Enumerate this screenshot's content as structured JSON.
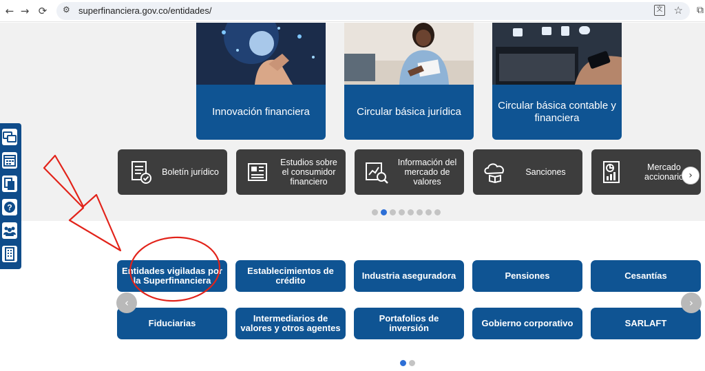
{
  "browser": {
    "url": "superfinanciera.gov.co/entidades/",
    "back_icon": "←",
    "forward_icon": "→",
    "reload_icon": "⟳",
    "site_settings_icon": "⚙",
    "translate_icon": "文",
    "bookmark_icon": "☆",
    "extension_icon": "⧉"
  },
  "feature_cards": [
    {
      "label": "Innovación financiera"
    },
    {
      "label": "Circular básica jurídica"
    },
    {
      "label": "Circular básica contable y financiera"
    }
  ],
  "service_cards": [
    {
      "label": "Boletín jurídico",
      "icon": "document-check-icon"
    },
    {
      "label": "Estudios sobre el consumidor financiero",
      "icon": "newspaper-icon"
    },
    {
      "label": "Información del mercado de valores",
      "icon": "market-search-icon"
    },
    {
      "label": "Sanciones",
      "icon": "cloud-book-icon"
    },
    {
      "label": "Mercado accionario",
      "icon": "report-chart-icon"
    }
  ],
  "service_carousel": {
    "next_icon": "›",
    "page_count": 8,
    "active_page": 2
  },
  "side_toolbar": {
    "items": [
      {
        "icon": "chat-icon"
      },
      {
        "icon": "calendar-icon"
      },
      {
        "icon": "documents-icon"
      },
      {
        "icon": "help-icon",
        "glyph": "?"
      },
      {
        "icon": "group-icon"
      },
      {
        "icon": "building-icon"
      }
    ]
  },
  "categories": {
    "row1": [
      {
        "label": "Entidades vigiladas por la Superfinanciera"
      },
      {
        "label": "Establecimientos de crédito"
      },
      {
        "label": "Industria aseguradora"
      },
      {
        "label": "Pensiones"
      },
      {
        "label": "Cesantías"
      }
    ],
    "row2": [
      {
        "label": "Fiduciarias"
      },
      {
        "label": "Intermediarios de valores y otros agentes"
      },
      {
        "label": "Portafolios de inversión"
      },
      {
        "label": "Gobierno corporativo"
      },
      {
        "label": "SARLAFT"
      }
    ],
    "prev_icon": "‹",
    "next_icon": "›",
    "page_count": 2,
    "active_page": 1
  },
  "colors": {
    "brand_blue": "#0f5493",
    "dark_card": "#3d3d3d",
    "annotation_red": "#e2231a",
    "dot_active": "#2d6fd6"
  }
}
